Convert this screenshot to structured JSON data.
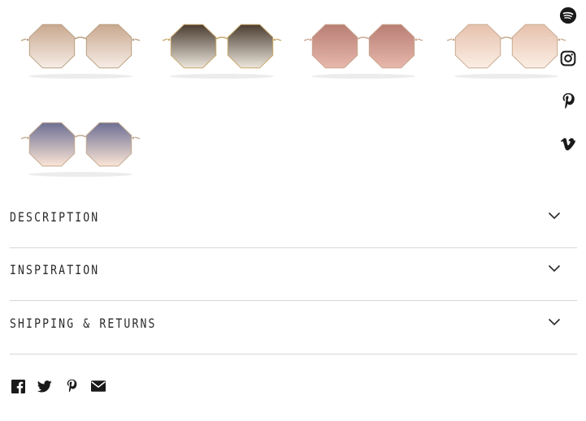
{
  "gallery": {
    "thumbnails": [
      {
        "name": "thumb-gradient-brown-light",
        "lens_top": "#c9a88f",
        "lens_bottom": "#f6ede6",
        "frame": "#b8a080"
      },
      {
        "name": "thumb-gradient-dark-brown",
        "lens_top": "#4a3c30",
        "lens_bottom": "#ece6dc",
        "frame": "#c9a86a"
      },
      {
        "name": "thumb-rose",
        "lens_top": "#b87e74",
        "lens_bottom": "#e7b7ac",
        "frame": "#c9a58e"
      },
      {
        "name": "thumb-peach",
        "lens_top": "#e6c1ac",
        "lens_bottom": "#fbeee5",
        "frame": "#c8aa90"
      },
      {
        "name": "thumb-blue-peach",
        "lens_top": "#6d6f93",
        "lens_bottom": "#fbe5d6",
        "frame": "#c2a98e"
      }
    ]
  },
  "social_rail": {
    "icons": [
      "spotify-icon",
      "instagram-icon",
      "pinterest-icon",
      "vimeo-icon"
    ]
  },
  "accordion": {
    "items": [
      {
        "label": "DESCRIPTION"
      },
      {
        "label": "INSPIRATION"
      },
      {
        "label": "SHIPPING & RETURNS"
      }
    ]
  },
  "share": {
    "icons": [
      "facebook-icon",
      "twitter-icon",
      "pinterest-icon",
      "email-icon"
    ]
  },
  "colors": {
    "text": "#2a2a2a",
    "divider": "#d6d6d6",
    "icon": "#1a1a1a"
  }
}
